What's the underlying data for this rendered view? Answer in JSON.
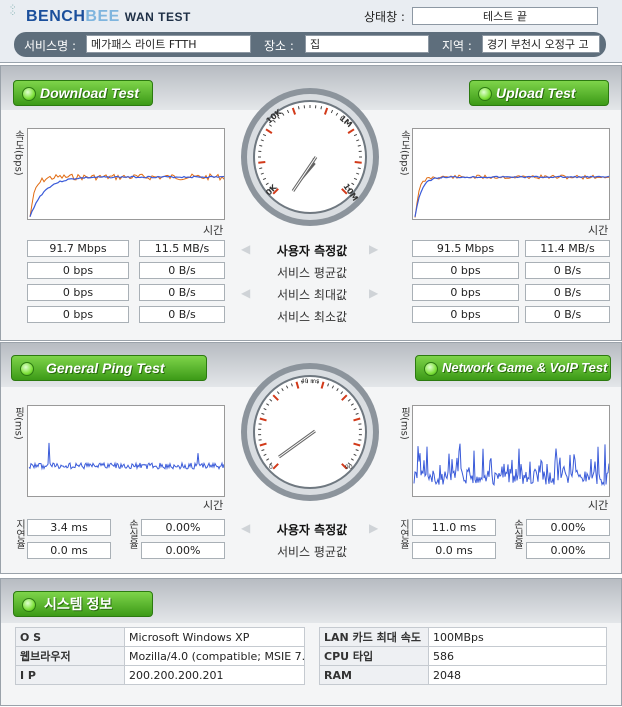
{
  "header": {
    "logo_bench": "BENCH",
    "logo_bee": "BEE",
    "logo_suffix": "WAN TEST",
    "status_label": "상태창 :",
    "status_value": "테스트 끝",
    "service_label": "서비스명 :",
    "service_value": "메가패스 라이트 FTTH",
    "place_label": "장소 :",
    "place_value": "집",
    "region_label": "지역 :",
    "region_value": "경기 부천시 오정구 고"
  },
  "speed": {
    "download_button": "Download Test",
    "upload_button": "Upload Test",
    "chart_ylabel": "속도(bps)",
    "chart_xlabel": "시간",
    "gauge_ticks": [
      "0K",
      "10K",
      "100K",
      "400",
      "600",
      "800",
      "1M",
      "10M"
    ],
    "row_labels": [
      "사용자 측정값",
      "서비스 평균값",
      "서비스 최대값",
      "서비스 최소값"
    ],
    "download_rows": [
      [
        "91.7 Mbps",
        "11.5 MB/s"
      ],
      [
        "0 bps",
        "0 B/s"
      ],
      [
        "0 bps",
        "0 B/s"
      ],
      [
        "0 bps",
        "0 B/s"
      ]
    ],
    "upload_rows": [
      [
        "91.5 Mbps",
        "11.4 MB/s"
      ],
      [
        "0 bps",
        "0 B/s"
      ],
      [
        "0 bps",
        "0 B/s"
      ],
      [
        "0 bps",
        "0 B/s"
      ]
    ]
  },
  "ping": {
    "ping_button": "General Ping Test",
    "game_button": "Network Game & VoIP Test",
    "chart_ylabel": "핑(ms)",
    "chart_xlabel": "시간",
    "latency_label": "지연율",
    "loss_label": "손실율",
    "gauge_ticks": [
      "0",
      "10 ms",
      "20 ms",
      "30 ms",
      "40 ms",
      "50 ms",
      "60 ms",
      "70 ms",
      "80 ms",
      "90"
    ],
    "row_labels": [
      "사용자 측정값",
      "서비스 평균값"
    ],
    "left_rows": [
      [
        "3.4 ms",
        "0.00%"
      ],
      [
        "0.0 ms",
        "0.00%"
      ]
    ],
    "right_rows": [
      [
        "11.0 ms",
        "0.00%"
      ],
      [
        "0.0 ms",
        "0.00%"
      ]
    ]
  },
  "system": {
    "button": "시스템 정보",
    "rows_left": [
      {
        "key": "O S",
        "value": "Microsoft Windows XP"
      },
      {
        "key": "웹브라우저",
        "value": "Mozilla/4.0 (compatible; MSIE 7.0;"
      },
      {
        "key": "I P",
        "value": "200.200.200.201"
      }
    ],
    "rows_right": [
      {
        "key": "LAN 카드 최대 속도",
        "value": "100MBps"
      },
      {
        "key": "CPU 타입",
        "value": "586"
      },
      {
        "key": "RAM",
        "value": "2048"
      }
    ]
  },
  "colors": {
    "series_blue": "#3a5bd9",
    "series_orange": "#e06a10",
    "green_button": "#4caf22",
    "header_bar": "#5e6e7c"
  }
}
